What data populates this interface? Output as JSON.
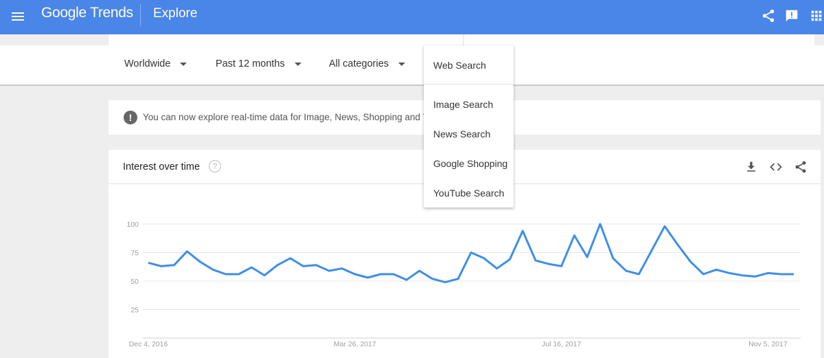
{
  "header": {
    "logo": "Google Trends",
    "title": "Explore",
    "bar_color": "#4a85e8"
  },
  "filters": [
    {
      "label": "Worldwide"
    },
    {
      "label": "Past 12 months"
    },
    {
      "label": "All categories"
    }
  ],
  "search_type_menu": {
    "items": [
      "Web Search",
      "Image Search",
      "News Search",
      "Google Shopping",
      "YouTube Search"
    ],
    "selected": "Web Search"
  },
  "notice": {
    "text": "You can now explore real-time data for Image, News, Shopping and Youtu"
  },
  "chart_card": {
    "title": "Interest over time"
  },
  "chart_data": {
    "type": "line",
    "title": "",
    "ylim": [
      0,
      100
    ],
    "y_ticks": [
      "100",
      "75",
      "50",
      "25"
    ],
    "y_tick_values": [
      100,
      75,
      50,
      25
    ],
    "x_tick_labels": [
      "Dec 4, 2016",
      "Mar 26, 2017",
      "Jul 16, 2017",
      "Nov 5, 2017"
    ],
    "x_tick_index": [
      0,
      16,
      32,
      48
    ],
    "grid": true,
    "line_color": "#3e8ee8",
    "series": [
      {
        "values": [
          66,
          63,
          64,
          76,
          67,
          60,
          56,
          56,
          62,
          55,
          64,
          70,
          63,
          64,
          59,
          61,
          56,
          53,
          56,
          56,
          51,
          59,
          52,
          49,
          52,
          75,
          70,
          61,
          69,
          94,
          68,
          65,
          63,
          90,
          71,
          100,
          70,
          59,
          56,
          77,
          98,
          82,
          67,
          56,
          60,
          57,
          55,
          54,
          57,
          56,
          56
        ]
      }
    ]
  }
}
